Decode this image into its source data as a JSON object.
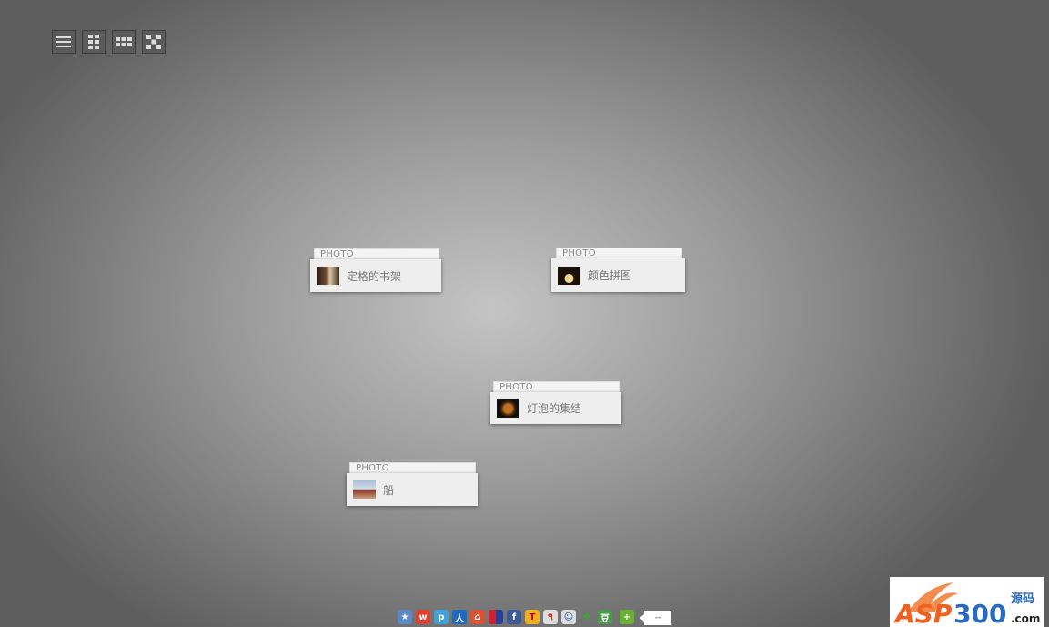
{
  "view_modes": [
    {
      "name": "list"
    },
    {
      "name": "column"
    },
    {
      "name": "grid"
    },
    {
      "name": "scatter"
    }
  ],
  "cards": [
    {
      "type": "PHOTO",
      "title": "定格的书架"
    },
    {
      "type": "PHOTO",
      "title": "颜色拼图"
    },
    {
      "type": "PHOTO",
      "title": "灯泡的集结"
    },
    {
      "type": "PHOTO",
      "title": "船"
    }
  ],
  "share": {
    "icons": [
      "qzone",
      "weibo",
      "pengyou",
      "renren",
      "kaixin",
      "taobao",
      "facebook",
      "tqq",
      "netease",
      "sohu",
      "clover",
      "douban",
      "more"
    ],
    "count": "--"
  },
  "logo": {
    "text": "ASP300",
    "sub": "源码",
    "domain": ".com"
  }
}
